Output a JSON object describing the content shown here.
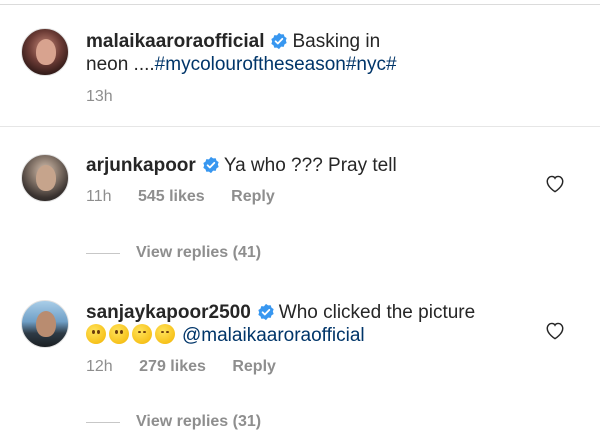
{
  "post": {
    "username": "malaikaaroraofficial",
    "caption_text": "Basking in",
    "caption_line2_prefix": "neon ....",
    "caption_tags": "#mycolouroftheseason#nyc#",
    "time": "13h"
  },
  "comments": [
    {
      "username": "arjunkapoor",
      "text": "Ya who ??? Pray tell",
      "time": "11h",
      "likes": "545 likes",
      "reply_label": "Reply",
      "view_replies": "View replies (41)"
    },
    {
      "username": "sanjaykapoor2500",
      "text": "Who clicked the picture",
      "emojis": [
        "thinking-face",
        "thinking-face",
        "tears-of-joy",
        "tears-of-joy"
      ],
      "mention": "@malaikaaroraofficial",
      "time": "12h",
      "likes": "279 likes",
      "reply_label": "Reply",
      "view_replies": "View replies (31)"
    }
  ],
  "colors": {
    "verified_badge": "#3897f0",
    "hashtag": "#003569",
    "muted_text": "#8e8e8e"
  },
  "icons": {
    "verified": "verified-badge-icon",
    "like": "heart-outline-icon"
  }
}
